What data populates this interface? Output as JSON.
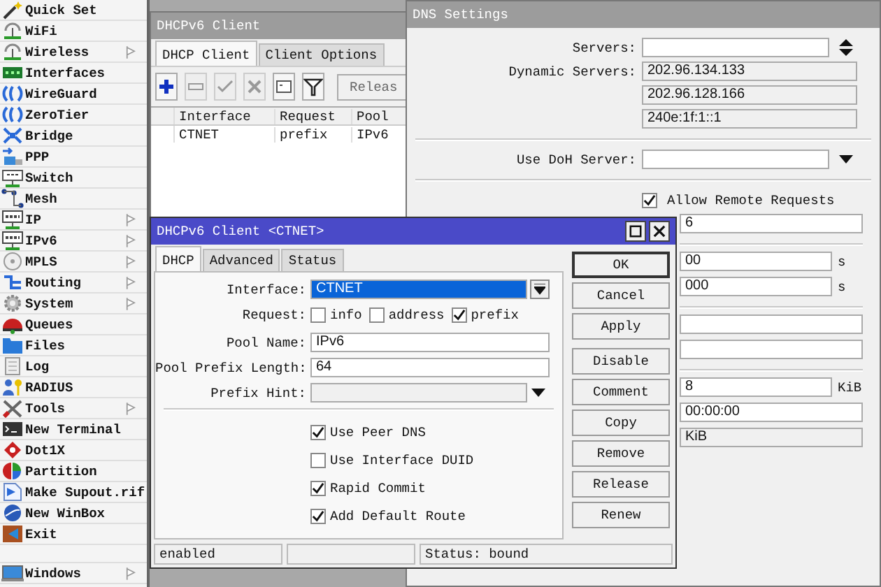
{
  "sidebar": {
    "items": [
      {
        "label": "Quick Set",
        "submenu": false
      },
      {
        "label": "WiFi",
        "submenu": false
      },
      {
        "label": "Wireless",
        "submenu": true
      },
      {
        "label": "Interfaces",
        "submenu": false
      },
      {
        "label": "WireGuard",
        "submenu": false
      },
      {
        "label": "ZeroTier",
        "submenu": false
      },
      {
        "label": "Bridge",
        "submenu": false
      },
      {
        "label": "PPP",
        "submenu": false
      },
      {
        "label": "Switch",
        "submenu": false
      },
      {
        "label": "Mesh",
        "submenu": false
      },
      {
        "label": "IP",
        "submenu": true
      },
      {
        "label": "IPv6",
        "submenu": true
      },
      {
        "label": "MPLS",
        "submenu": true
      },
      {
        "label": "Routing",
        "submenu": true
      },
      {
        "label": "System",
        "submenu": true
      },
      {
        "label": "Queues",
        "submenu": false
      },
      {
        "label": "Files",
        "submenu": false
      },
      {
        "label": "Log",
        "submenu": false
      },
      {
        "label": "RADIUS",
        "submenu": false
      },
      {
        "label": "Tools",
        "submenu": true
      },
      {
        "label": "New Terminal",
        "submenu": false
      },
      {
        "label": "Dot1X",
        "submenu": false
      },
      {
        "label": "Partition",
        "submenu": false
      },
      {
        "label": "Make Supout.rif",
        "submenu": false
      },
      {
        "label": "New WinBox",
        "submenu": false
      },
      {
        "label": "Exit",
        "submenu": false
      }
    ],
    "footer": {
      "label": "Windows",
      "submenu": true
    }
  },
  "dhcp_window": {
    "title": "DHCPv6 Client",
    "active": false,
    "tabs": [
      {
        "label": "DHCP Client",
        "selected": true
      },
      {
        "label": "Client Options",
        "selected": false
      }
    ],
    "toolbar": [
      {
        "kind": "add",
        "disabled": false
      },
      {
        "kind": "remove",
        "disabled": true
      },
      {
        "kind": "enable",
        "disabled": true
      },
      {
        "kind": "disable",
        "disabled": true
      },
      {
        "kind": "comment",
        "disabled": false
      },
      {
        "kind": "filter",
        "disabled": false
      }
    ],
    "text_button": "Releas",
    "table": {
      "columns": [
        "Interface",
        "Request",
        "Pool"
      ],
      "rows": [
        [
          "CTNET",
          "prefix",
          "IPv6"
        ]
      ]
    }
  },
  "dns_window": {
    "title": "DNS Settings",
    "active": false,
    "fields": [
      {
        "kind": "spin",
        "label": "Servers:"
      },
      {
        "kind": "readonly",
        "label": "Dynamic Servers:",
        "value": "202.96.134.133"
      },
      {
        "kind": "readonly",
        "value": "202.96.128.166"
      },
      {
        "kind": "readonly",
        "value": "240e:1f:1::1"
      },
      {
        "kind": "divider"
      },
      {
        "kind": "dropdown",
        "label": "Use DoH Server:"
      },
      {
        "kind": "divider"
      },
      {
        "kind": "checkbox",
        "label": "Allow Remote Requests",
        "checked": true
      }
    ],
    "lower_fields": [
      {
        "kind": "text",
        "value": "6"
      },
      {
        "kind": "divider"
      },
      {
        "kind": "text",
        "value": "00",
        "suffix": "s"
      },
      {
        "kind": "text",
        "value": "000",
        "suffix": "s"
      },
      {
        "kind": "divider"
      },
      {
        "kind": "text"
      },
      {
        "kind": "text"
      },
      {
        "kind": "divider"
      },
      {
        "kind": "text",
        "value": "8",
        "suffix": "KiB"
      },
      {
        "kind": "text",
        "value": "00:00:00"
      },
      {
        "kind": "readonly",
        "value": "KiB"
      }
    ]
  },
  "dialog": {
    "title": "DHCPv6 Client <CTNET>",
    "active": true,
    "tabs": [
      {
        "label": "DHCP",
        "selected": true
      },
      {
        "label": "Advanced",
        "selected": false
      },
      {
        "label": "Status",
        "selected": false
      }
    ],
    "form": [
      {
        "kind": "select",
        "label": "Interface:",
        "value": "CTNET",
        "highlighted": true
      },
      {
        "kind": "checks",
        "label": "Request:",
        "options": [
          {
            "label": "info",
            "checked": false
          },
          {
            "label": "address",
            "checked": false
          },
          {
            "label": "prefix",
            "checked": true
          }
        ]
      },
      {
        "kind": "text",
        "label": "Pool Name:",
        "value": "IPv6"
      },
      {
        "kind": "text",
        "label": "Pool Prefix Length:",
        "value": "64"
      },
      {
        "kind": "dropdown",
        "label": "Prefix Hint:",
        "disabled": true
      },
      {
        "kind": "divider"
      },
      {
        "kind": "checkbox",
        "label": "Use Peer DNS",
        "checked": true
      },
      {
        "kind": "checkbox",
        "label": "Use Interface DUID",
        "checked": false
      },
      {
        "kind": "checkbox",
        "label": "Rapid Commit",
        "checked": true
      },
      {
        "kind": "checkbox",
        "label": "Add Default Route",
        "checked": true
      }
    ],
    "button_groups": [
      [
        {
          "label": "OK",
          "default": true
        },
        {
          "label": "Cancel",
          "default": false
        },
        {
          "label": "Apply",
          "default": false
        }
      ],
      [
        {
          "label": "Disable",
          "default": false
        },
        {
          "label": "Comment",
          "default": false
        },
        {
          "label": "Copy",
          "default": false
        },
        {
          "label": "Remove",
          "default": false
        },
        {
          "label": "Release",
          "default": false
        },
        {
          "label": "Renew",
          "default": false
        }
      ]
    ],
    "status_bar": {
      "state": "enabled",
      "status": "Status: bound"
    }
  }
}
